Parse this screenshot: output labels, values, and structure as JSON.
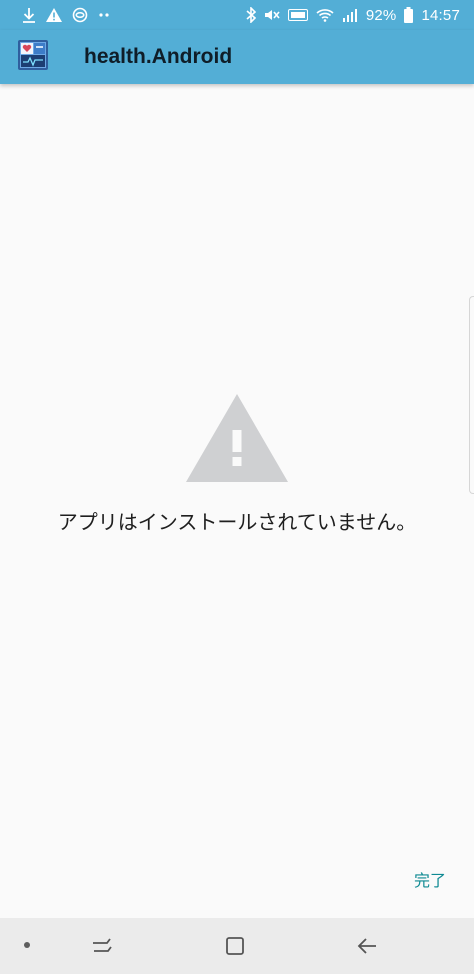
{
  "status_bar": {
    "battery": "92%",
    "time": "14:57",
    "left_icons": [
      "download-icon",
      "warning-icon",
      "app-notification-icon",
      "more-dots-icon"
    ],
    "right_icons": [
      "bluetooth-icon",
      "mute-icon",
      "volte-icon",
      "wifi-icon",
      "signal-icon",
      "battery-icon"
    ]
  },
  "app_bar": {
    "title": "health.Android",
    "icon": "health-app-icon"
  },
  "content": {
    "message": "アプリはインストールされていません。",
    "icon": "warning-triangle-icon"
  },
  "actions": {
    "done_label": "完了"
  },
  "colors": {
    "primary": "#53aed6",
    "accent": "#0f8a93",
    "icon_grey": "#cfd0d2",
    "background": "#fafafa"
  },
  "nav_bar": {
    "icons": [
      "nav-dot-icon",
      "recent-apps-icon",
      "home-icon",
      "back-icon"
    ]
  }
}
